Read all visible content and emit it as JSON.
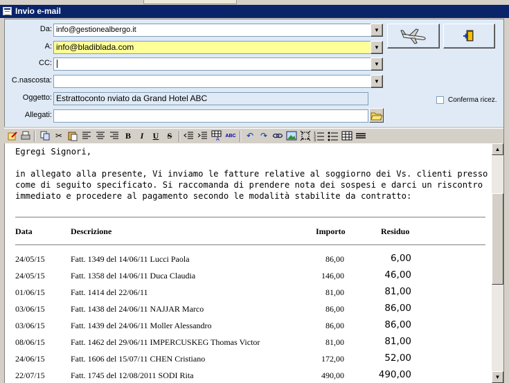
{
  "window": {
    "title": "Invio e-mail"
  },
  "fields": {
    "da_label": "Da:",
    "da_value": "info@gestionealbergo.it",
    "a_label": "A:",
    "a_value": "info@bladiblada.com",
    "cc_label": "CC:",
    "cc_value": "",
    "ccn_label": "C.nascosta:",
    "ccn_value": "",
    "oggetto_label": "Oggetto:",
    "oggetto_value": "Estrattoconto nviato da Grand Hotel ABC",
    "allegati_label": "Allegati:",
    "allegati_value": ""
  },
  "conferma_label": "Conferma ricez.",
  "toolbar": {
    "bold": "B",
    "italic": "I",
    "underline": "U",
    "strike": "S",
    "spell": "ABC"
  },
  "message": {
    "greeting": "Egregi Signori,",
    "para_lines": [
      "in allegato alla presente, Vi inviamo le fatture relative al soggiorno dei Vs. clienti presso il ns. albergo,",
      "come di seguito specificato. Si raccomanda di prendere nota dei sospesi e darci un riscontro",
      "immediato e procedere al pagamento secondo le modalità stabilite da contratto:"
    ],
    "table": {
      "headers": {
        "data": "Data",
        "descrizione": "Descrizione",
        "importo": "Importo",
        "residuo": "Residuo"
      },
      "rows": [
        {
          "data": "24/05/15",
          "descrizione": "Fatt. 1349 del 14/06/11 Lucci Paola",
          "importo": "86,00",
          "residuo": "6,00"
        },
        {
          "data": "24/05/15",
          "descrizione": "Fatt. 1358 del 14/06/11 Duca Claudia",
          "importo": "146,00",
          "residuo": "46,00"
        },
        {
          "data": "01/06/15",
          "descrizione": "Fatt. 1414 del 22/06/11",
          "importo": "81,00",
          "residuo": "81,00"
        },
        {
          "data": "03/06/15",
          "descrizione": "Fatt. 1438 del 24/06/11 NAJJAR Marco",
          "importo": "86,00",
          "residuo": "86,00"
        },
        {
          "data": "03/06/15",
          "descrizione": "Fatt. 1439 del 24/06/11 Moller Alessandro",
          "importo": "86,00",
          "residuo": "86,00"
        },
        {
          "data": "08/06/15",
          "descrizione": "Fatt. 1462 del 29/06/11 IMPERCUSKEG Thomas Victor",
          "importo": "81,00",
          "residuo": "81,00"
        },
        {
          "data": "24/06/15",
          "descrizione": "Fatt. 1606 del 15/07/11 CHEN Cristiano",
          "importo": "172,00",
          "residuo": "52,00"
        },
        {
          "data": "22/07/15",
          "descrizione": "Fatt. 1745 del 12/08/2011 SODI Rita",
          "importo": "490,00",
          "residuo": "490,00"
        }
      ]
    }
  }
}
